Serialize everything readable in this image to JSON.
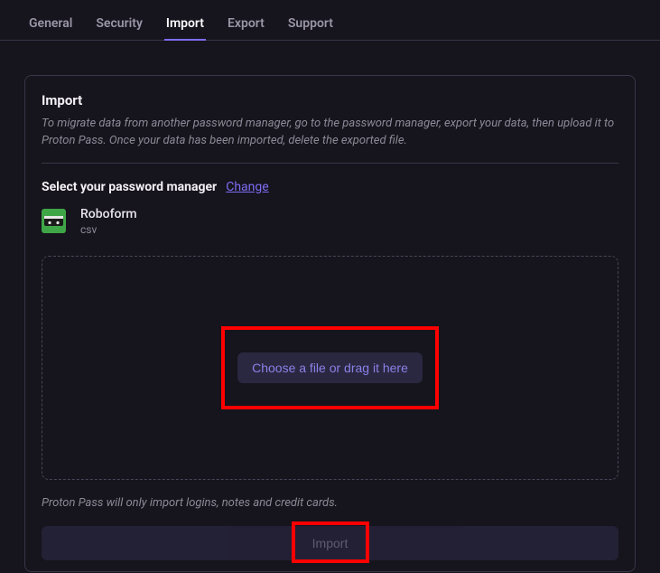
{
  "tabs": {
    "general": "General",
    "security": "Security",
    "import": "Import",
    "export": "Export",
    "support": "Support"
  },
  "panel": {
    "title": "Import",
    "description": "To migrate data from another password manager, go to the password manager, export your data, then upload it to Proton Pass. Once your data has been imported, delete the exported file.",
    "select_label": "Select your password manager",
    "change_link": "Change",
    "provider": {
      "name": "Roboform",
      "format": "csv"
    },
    "choose_button": "Choose a file or drag it here",
    "note": "Proton Pass will only import logins, notes and credit cards.",
    "import_button": "Import"
  }
}
